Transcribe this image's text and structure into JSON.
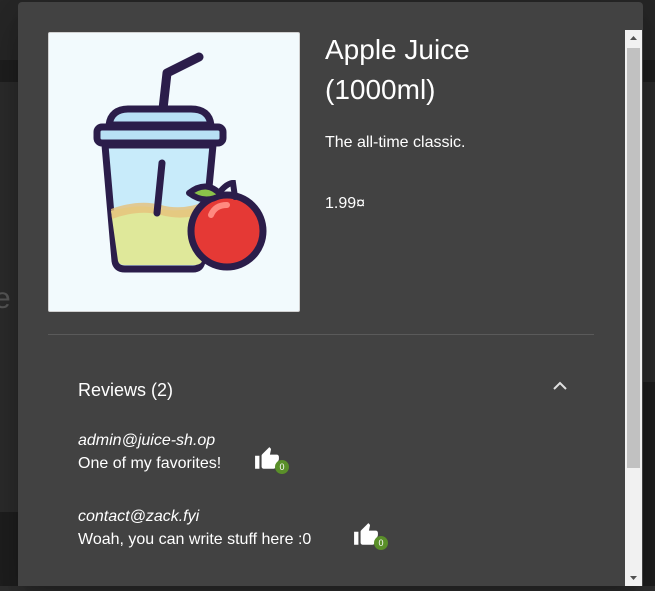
{
  "product": {
    "name": "Apple Juice (1000ml)",
    "description": "The all-time classic.",
    "price": "1.99¤",
    "image_icon": "apple-juice-icon"
  },
  "reviews": {
    "title": "Reviews (2)",
    "toggle_icon": "chevron-up-icon",
    "items": [
      {
        "author": "admin@juice-sh.op",
        "text": "One of my favorites!",
        "likes": "0"
      },
      {
        "author": "contact@zack.fyi",
        "text": "Woah, you can write stuff here :0",
        "likes": "0"
      }
    ]
  },
  "background": {
    "partial_letter": "e"
  },
  "colors": {
    "dialog_bg": "#424242",
    "badge": "#5a8f29",
    "apple_red": "#e53935",
    "cup_outline": "#2b1d4a"
  }
}
